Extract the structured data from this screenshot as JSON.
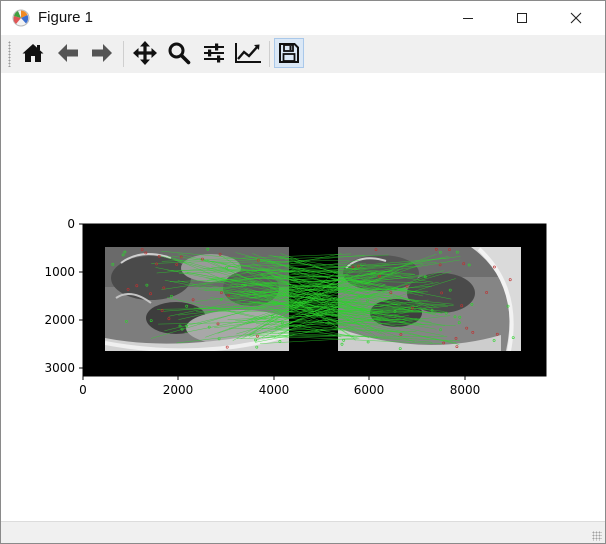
{
  "window": {
    "title": "Figure 1"
  },
  "toolbar": {
    "buttons": [
      {
        "name": "home",
        "icon": "home-icon"
      },
      {
        "name": "back",
        "icon": "arrow-left-icon"
      },
      {
        "name": "forward",
        "icon": "arrow-right-icon"
      },
      {
        "name": "pan",
        "icon": "move-icon"
      },
      {
        "name": "zoom",
        "icon": "magnifier-icon"
      },
      {
        "name": "configure-subplots",
        "icon": "sliders-icon"
      },
      {
        "name": "edit-axis",
        "icon": "line-chart-icon"
      },
      {
        "name": "save",
        "icon": "floppy-disk-icon"
      }
    ]
  },
  "plot": {
    "image_kind": "feature-matching visualization of two grayscale photos side by side with green match lines",
    "x_ticks": [
      "0",
      "2000",
      "4000",
      "6000",
      "8000"
    ],
    "y_ticks": [
      "0",
      "1000",
      "2000",
      "3000"
    ],
    "xlim": [
      0,
      9700
    ],
    "ylim": [
      3200,
      0
    ],
    "colors": {
      "background": "#000000",
      "matches": "#2bd62b",
      "keypoints": "#c03030"
    }
  }
}
